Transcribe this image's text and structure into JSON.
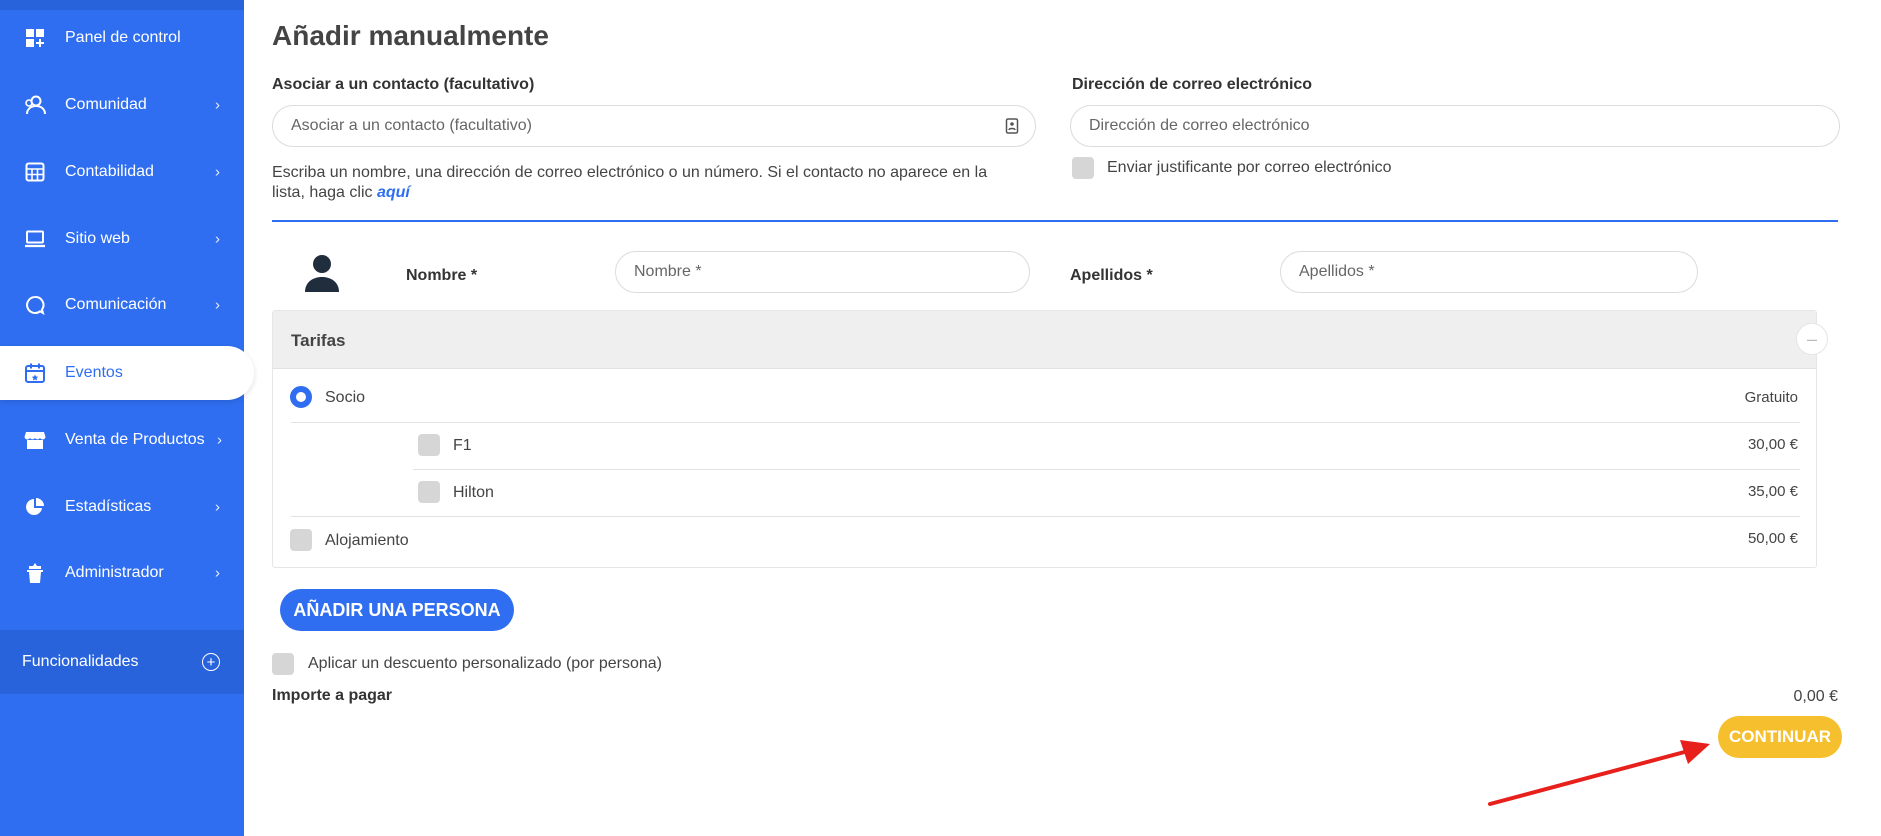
{
  "sidebar": {
    "items": [
      {
        "label": "Panel de control",
        "icon": "dashboard-icon",
        "chevron": ""
      },
      {
        "label": "Comunidad",
        "icon": "community-icon",
        "chevron": "›"
      },
      {
        "label": "Contabilidad",
        "icon": "calculator-icon",
        "chevron": "›"
      },
      {
        "label": "Sitio web",
        "icon": "laptop-icon",
        "chevron": "›"
      },
      {
        "label": "Comunicación",
        "icon": "chat-icon",
        "chevron": "›"
      },
      {
        "label": "Eventos",
        "icon": "calendar-icon",
        "chevron": ""
      },
      {
        "label": "Venta de Productos",
        "icon": "store-icon",
        "chevron": "›"
      },
      {
        "label": "Estadísticas",
        "icon": "pie-chart-icon",
        "chevron": "›"
      },
      {
        "label": "Administrador",
        "icon": "admin-icon",
        "chevron": "›"
      }
    ],
    "active_index": 5,
    "funcionalidades": "Funcionalidades",
    "funcionalidades_icon": "add-circle-icon"
  },
  "main": {
    "title": "Añadir manualmente",
    "contact": {
      "label": "Asociar a un contacto (facultativo)",
      "placeholder": "Asociar a un contacto (facultativo)",
      "icon": "contact-book-icon"
    },
    "email": {
      "label": "Dirección de correo electrónico",
      "placeholder": "Dirección de correo electrónico",
      "send_receipt": "Enviar justificante por correo electrónico"
    },
    "help": {
      "text": "Escriba un nombre, una dirección de correo electrónico o un número. Si el contacto no aparece en la lista, haga clic ",
      "link": "aquí"
    },
    "person": {
      "avatar_icon": "user-avatar-icon",
      "nombre_label": "Nombre *",
      "nombre_placeholder": "Nombre *",
      "apellidos_label": "Apellidos *",
      "apellidos_placeholder": "Apellidos *"
    },
    "tarifas": {
      "title": "Tarifas",
      "collapse": "–",
      "rows": [
        {
          "label": "Socio",
          "price": "Gratuito",
          "type": "radio",
          "selected": true
        },
        {
          "label": "F1",
          "price": "30,00 €",
          "type": "checkbox",
          "indent": true
        },
        {
          "label": "Hilton",
          "price": "35,00 €",
          "type": "checkbox",
          "indent": true
        },
        {
          "label": "Alojamiento",
          "price": "50,00 €",
          "type": "checkbox"
        }
      ]
    },
    "add_person": "AÑADIR UNA PERSONA",
    "discount": "Aplicar un descuento personalizado (por persona)",
    "total_label": "Importe a pagar",
    "total_value": "0,00 €",
    "continue": "CONTINUAR"
  },
  "colors": {
    "primary": "#2f6ef0",
    "accent": "#f5bf2d",
    "arrow": "#e8201c"
  }
}
